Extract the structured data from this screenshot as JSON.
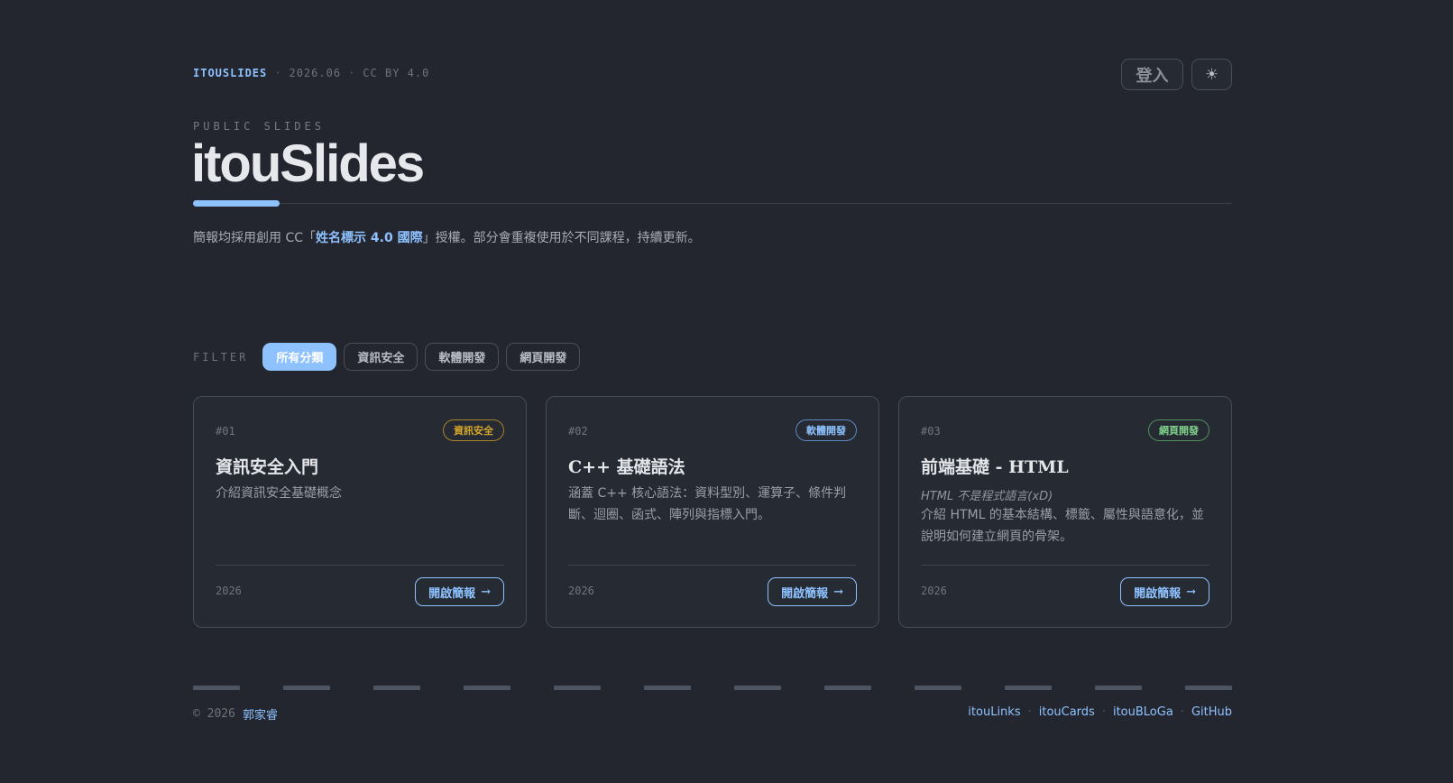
{
  "header": {
    "brand": "ITOUSLIDES",
    "date": "2026.06",
    "license": "CC BY 4.0",
    "login_label": "登入",
    "theme_icon": "☀"
  },
  "hero": {
    "eyebrow": "PUBLIC SLIDES",
    "title": "itouSlides",
    "desc_before": "簡報均採用創用 CC「",
    "desc_link": "姓名標示 4.0 國際",
    "desc_after": "」授權。部分會重複使用於不同課程，持續更新。"
  },
  "filter": {
    "label": "FILTER",
    "chips": [
      "所有分類",
      "資訊安全",
      "軟體開發",
      "網頁開發"
    ],
    "active": "所有分類"
  },
  "cards": [
    {
      "num": "#01",
      "tag": "資訊安全",
      "tag_color": "#d4a72c",
      "title": "資訊安全入門",
      "subtitle": "",
      "desc": "介紹資訊安全基礎概念",
      "year": "2026",
      "button": "開啟簡報"
    },
    {
      "num": "#02",
      "tag": "軟體開發",
      "tag_color": "#8ec2ff",
      "title": "C++ 基礎語法",
      "subtitle": "",
      "desc": "涵蓋 C++ 核心語法：資料型別、運算子、條件判斷、迴圈、函式、陣列與指標入門。",
      "year": "2026",
      "button": "開啟簡報"
    },
    {
      "num": "#03",
      "tag": "網頁開發",
      "tag_color": "#7fd08a",
      "title": "前端基礎 - HTML",
      "subtitle": "HTML 不是程式語言(xD)",
      "desc": "介紹 HTML 的基本結構、標籤、屬性與語意化，並說明如何建立網頁的骨架。",
      "year": "2026",
      "button": "開啟簡報"
    }
  ],
  "footer": {
    "copyright": "© 2026",
    "author": "郭家睿",
    "links": [
      "itouLinks",
      "itouCards",
      "itouBLoGa",
      "GitHub"
    ]
  },
  "colors": {
    "accent": "#8ec2ff",
    "background": "#23262f"
  }
}
